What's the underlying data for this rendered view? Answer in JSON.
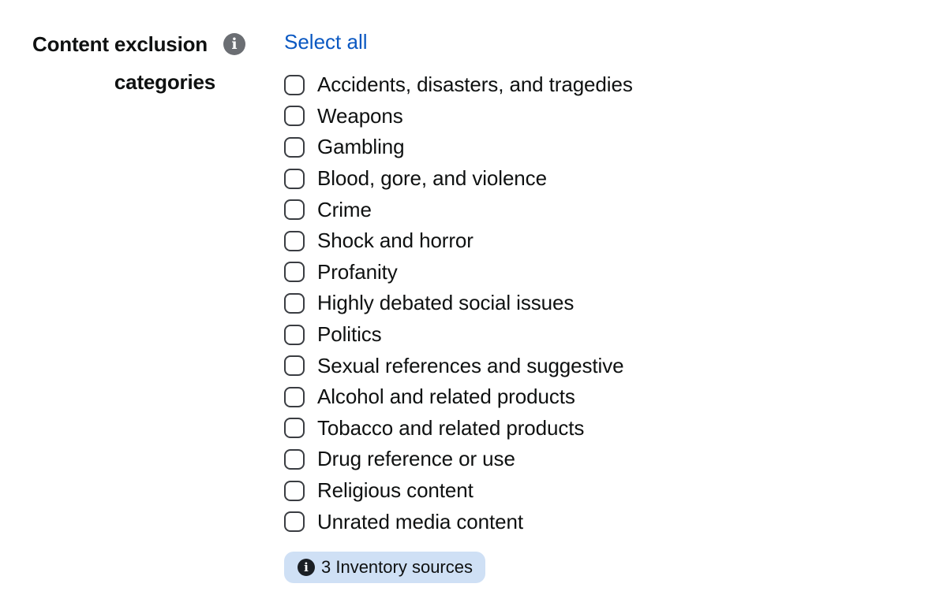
{
  "field": {
    "label_line1": "Content exclusion",
    "label_line2": "categories",
    "info_icon": "info-icon",
    "info_glyph": "i"
  },
  "select_all": {
    "label": "Select all",
    "color": "#0a58c2"
  },
  "options": [
    {
      "label": "Accidents, disasters, and tragedies",
      "checked": false
    },
    {
      "label": "Weapons",
      "checked": false
    },
    {
      "label": "Gambling",
      "checked": false
    },
    {
      "label": "Blood, gore, and violence",
      "checked": false
    },
    {
      "label": "Crime",
      "checked": false
    },
    {
      "label": "Shock and horror",
      "checked": false
    },
    {
      "label": "Profanity",
      "checked": false
    },
    {
      "label": "Highly debated social issues",
      "checked": false
    },
    {
      "label": "Politics",
      "checked": false
    },
    {
      "label": "Sexual references and suggestive",
      "checked": false
    },
    {
      "label": "Alcohol and related products",
      "checked": false
    },
    {
      "label": "Tobacco and related products",
      "checked": false
    },
    {
      "label": "Drug reference or use",
      "checked": false
    },
    {
      "label": "Religious content",
      "checked": false
    },
    {
      "label": "Unrated media content",
      "checked": false
    }
  ],
  "inventory_badge": {
    "text": "3 Inventory sources",
    "info_icon": "info-icon",
    "info_glyph": "i",
    "background": "#cfe0f5"
  }
}
